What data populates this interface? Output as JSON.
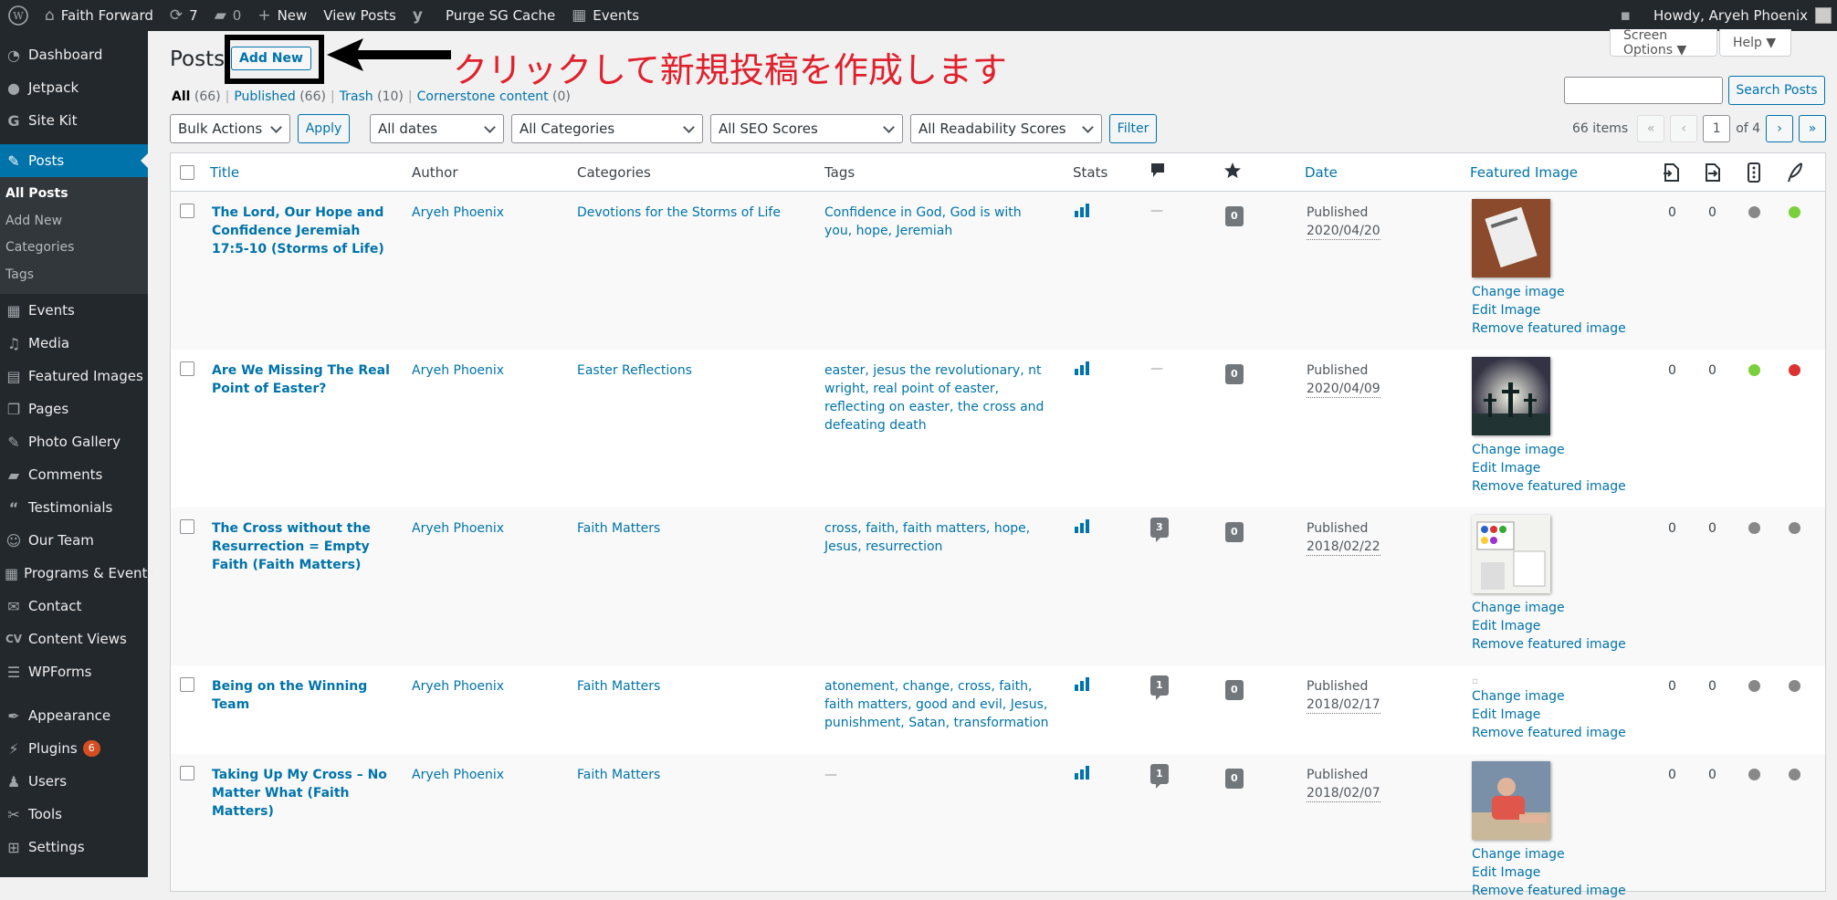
{
  "adminbar": {
    "site_name": "Faith Forward",
    "updates": "7",
    "comments": "0",
    "new": "New",
    "view_posts": "View Posts",
    "purge": "Purge SG Cache",
    "events": "Events",
    "howdy": "Howdy, Aryeh Phoenix"
  },
  "sidebar": {
    "items": [
      {
        "label": "Dashboard",
        "icon": "dashboard-icon"
      },
      {
        "label": "Jetpack",
        "icon": "jetpack-icon"
      },
      {
        "label": "Site Kit",
        "icon": "google-icon"
      },
      {
        "label": "Posts",
        "icon": "pin-icon"
      },
      {
        "label": "Events",
        "icon": "calendar-icon"
      },
      {
        "label": "Media",
        "icon": "media-icon"
      },
      {
        "label": "Featured Images",
        "icon": "images-icon"
      },
      {
        "label": "Pages",
        "icon": "pages-icon"
      },
      {
        "label": "Photo Gallery",
        "icon": "pin-icon"
      },
      {
        "label": "Comments",
        "icon": "comment-icon"
      },
      {
        "label": "Testimonials",
        "icon": "quote-icon"
      },
      {
        "label": "Our Team",
        "icon": "team-icon"
      },
      {
        "label": "Programs & Events",
        "icon": "calendar-icon"
      },
      {
        "label": "Contact",
        "icon": "mail-icon"
      },
      {
        "label": "Content Views",
        "icon": "cv-icon"
      },
      {
        "label": "WPForms",
        "icon": "forms-icon"
      },
      {
        "label": "Appearance",
        "icon": "brush-icon"
      },
      {
        "label": "Plugins",
        "icon": "plugin-icon",
        "badge": "6"
      },
      {
        "label": "Users",
        "icon": "user-icon"
      },
      {
        "label": "Tools",
        "icon": "wrench-icon"
      },
      {
        "label": "Settings",
        "icon": "settings-icon"
      }
    ],
    "submenu": [
      "All Posts",
      "Add New",
      "Categories",
      "Tags"
    ]
  },
  "page": {
    "title": "Posts",
    "add_new": "Add New",
    "annotation": "クリックして新規投稿を作成します",
    "screen_options": "Screen Options ▼",
    "help": "Help ▼"
  },
  "views": {
    "all": "All",
    "all_count": "(66)",
    "published": "Published",
    "published_count": "(66)",
    "trash": "Trash",
    "trash_count": "(10)",
    "cornerstone": "Cornerstone content",
    "cornerstone_count": "(0)"
  },
  "search": {
    "button": "Search Posts",
    "placeholder": ""
  },
  "filters": {
    "bulk": "Bulk Actions",
    "apply": "Apply",
    "dates": "All dates",
    "categories": "All Categories",
    "seo": "All SEO Scores",
    "readability": "All Readability Scores",
    "filter": "Filter"
  },
  "pagination": {
    "items": "66 items",
    "first": "«",
    "prev": "‹",
    "current": "1",
    "of": "of 4",
    "next": "›",
    "last": "»"
  },
  "columns": {
    "title": "Title",
    "author": "Author",
    "categories": "Categories",
    "tags": "Tags",
    "stats": "Stats",
    "date": "Date",
    "featured": "Featured Image"
  },
  "colors": {
    "accent": "#0073aa",
    "sidebar": "#23282d",
    "green": "#7ad03a",
    "red": "#dc3232",
    "grey": "#888888"
  },
  "rows": [
    {
      "title": "The Lord, Our Hope and Confidence Jeremiah 17:5-10 (Storms of Life)",
      "author": "Aryeh Phoenix",
      "category": "Devotions for the Storms of Life",
      "tags": "Confidence in God, God is with you, hope, Jeremiah",
      "comments": "—",
      "pending": "0",
      "status": "Published",
      "date": "2020/04/20",
      "links": "0",
      "linked": "0",
      "seo": "grey",
      "read": "green",
      "thumb": "book"
    },
    {
      "title": "Are We Missing The Real Point of Easter?",
      "author": "Aryeh Phoenix",
      "category": "Easter Reflections",
      "tags": "easter, jesus the revolutionary, nt wright, real point of easter, reflecting on easter, the cross and defeating death",
      "comments": "—",
      "pending": "0",
      "status": "Published",
      "date": "2020/04/09",
      "links": "0",
      "linked": "0",
      "seo": "green",
      "read": "red",
      "thumb": "crosses"
    },
    {
      "title": "The Cross without the Resurrection = Empty Faith (Faith Matters)",
      "author": "Aryeh Phoenix",
      "category": "Faith Matters",
      "tags": "cross, faith, faith matters, hope, Jesus, resurrection",
      "comments": "3",
      "pending": "0",
      "status": "Published",
      "date": "2018/02/22",
      "links": "0",
      "linked": "0",
      "seo": "grey",
      "read": "grey",
      "thumb": "paint"
    },
    {
      "title": "Being on the Winning Team",
      "author": "Aryeh Phoenix",
      "category": "Faith Matters",
      "tags": "atonement, change, cross, faith, faith matters, good and evil, Jesus, punishment, Satan, transformation",
      "comments": "1",
      "pending": "0",
      "status": "Published",
      "date": "2018/02/17",
      "links": "0",
      "linked": "0",
      "seo": "grey",
      "read": "grey",
      "thumb": "none"
    },
    {
      "title": "Taking Up My Cross – No Matter What (Faith Matters)",
      "author": "Aryeh Phoenix",
      "category": "Faith Matters",
      "tags": "—",
      "comments": "1",
      "pending": "0",
      "status": "Published",
      "date": "2018/02/07",
      "links": "0",
      "linked": "0",
      "seo": "grey",
      "read": "grey",
      "thumb": "person"
    }
  ],
  "fimg": {
    "change": "Change image",
    "edit": "Edit Image",
    "remove": "Remove featured image"
  }
}
